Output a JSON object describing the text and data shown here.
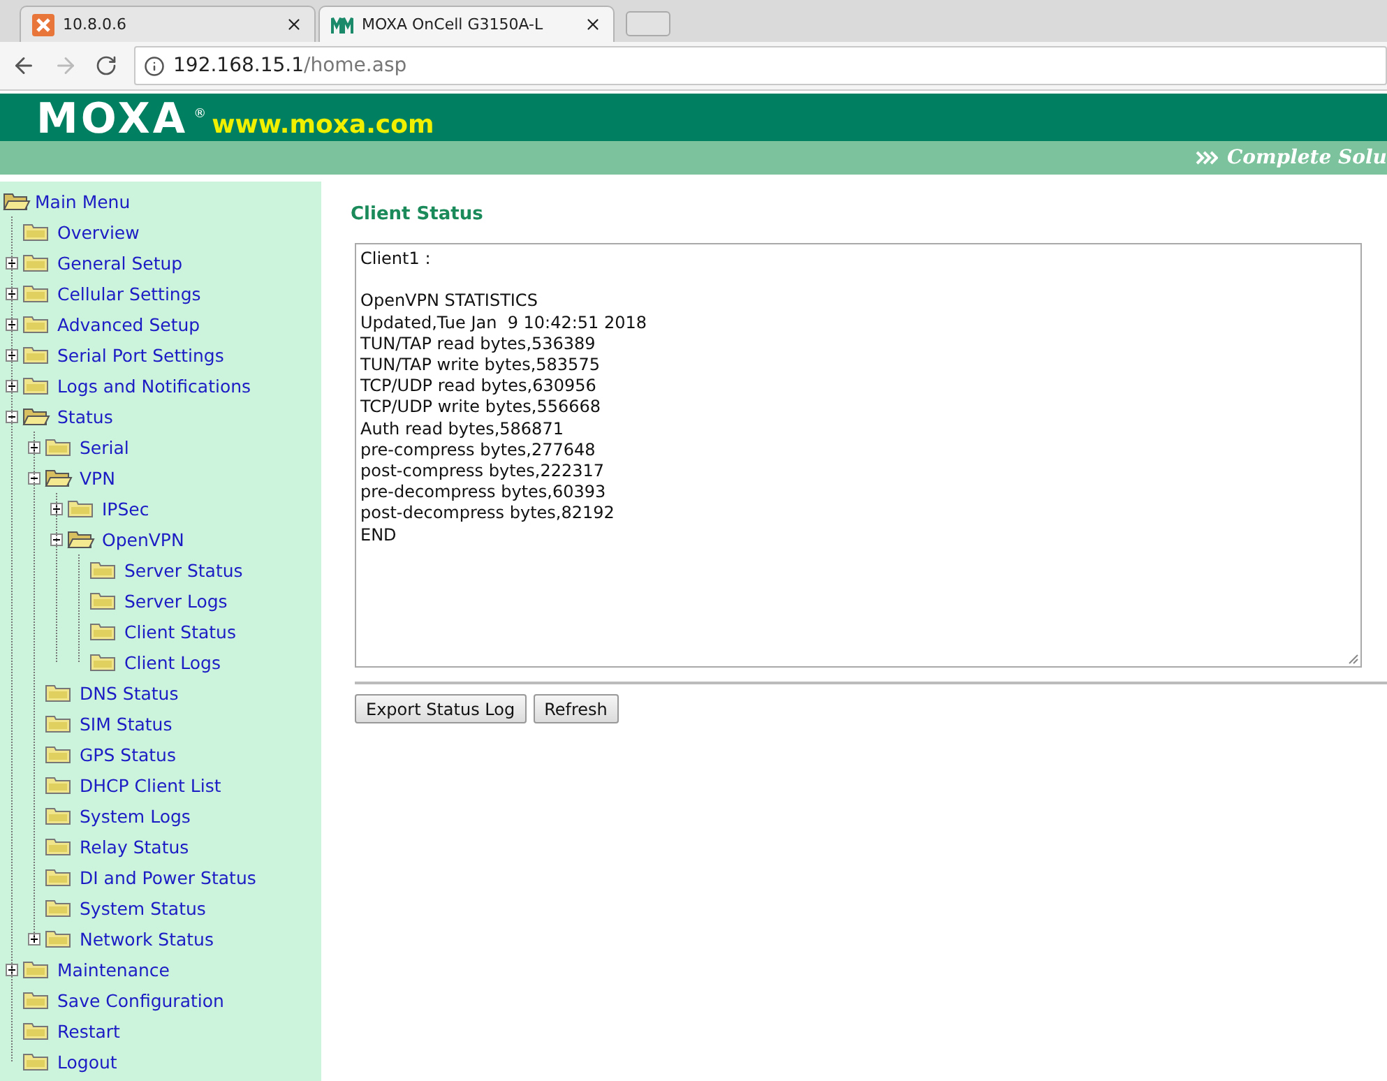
{
  "browser": {
    "tabs": [
      {
        "title": "10.8.0.6",
        "selected": false
      },
      {
        "title": "MOXA OnCell G3150A-L",
        "selected": true
      }
    ],
    "address": {
      "host": "192.168.15.1",
      "path": "/home.asp"
    }
  },
  "header": {
    "logo": "MOXA",
    "registered": "®",
    "site": "www.moxa.com",
    "tagline": "Complete Solu"
  },
  "menu": {
    "label": "Main Menu",
    "children": [
      {
        "label": "Overview"
      },
      {
        "label": "General Setup",
        "expanded": false
      },
      {
        "label": "Cellular Settings",
        "expanded": false
      },
      {
        "label": "Advanced Setup",
        "expanded": false
      },
      {
        "label": "Serial Port Settings",
        "expanded": false
      },
      {
        "label": "Logs and Notifications",
        "expanded": false
      },
      {
        "label": "Status",
        "expanded": true,
        "children": [
          {
            "label": "Serial",
            "expanded": false
          },
          {
            "label": "VPN",
            "expanded": true,
            "children": [
              {
                "label": "IPSec",
                "expanded": false
              },
              {
                "label": "OpenVPN",
                "expanded": true,
                "children": [
                  {
                    "label": "Server Status"
                  },
                  {
                    "label": "Server Logs"
                  },
                  {
                    "label": "Client Status"
                  },
                  {
                    "label": "Client Logs"
                  }
                ]
              }
            ]
          },
          {
            "label": "DNS Status"
          },
          {
            "label": "SIM Status"
          },
          {
            "label": "GPS Status"
          },
          {
            "label": "DHCP Client List"
          },
          {
            "label": "System Logs"
          },
          {
            "label": "Relay Status"
          },
          {
            "label": "DI and Power Status"
          },
          {
            "label": "System Status"
          },
          {
            "label": "Network Status",
            "expanded": false
          }
        ]
      },
      {
        "label": "Maintenance",
        "expanded": false
      },
      {
        "label": "Save Configuration"
      },
      {
        "label": "Restart"
      },
      {
        "label": "Logout"
      }
    ]
  },
  "content": {
    "title": "Client Status",
    "log": [
      [
        "Client1 :"
      ],
      [
        "OpenVPN STATISTICS",
        "Updated,Tue Jan  9 10:42:51 2018",
        "TUN/TAP read bytes,536389",
        "TUN/TAP write bytes,583575",
        "TCP/UDP read bytes,630956",
        "TCP/UDP write bytes,556668",
        "Auth read bytes,586871",
        "pre-compress bytes,277648",
        "post-compress bytes,222317",
        "pre-decompress bytes,60393",
        "post-decompress bytes,82192",
        "END"
      ]
    ],
    "buttons": [
      "Export Status Log",
      "Refresh"
    ]
  }
}
